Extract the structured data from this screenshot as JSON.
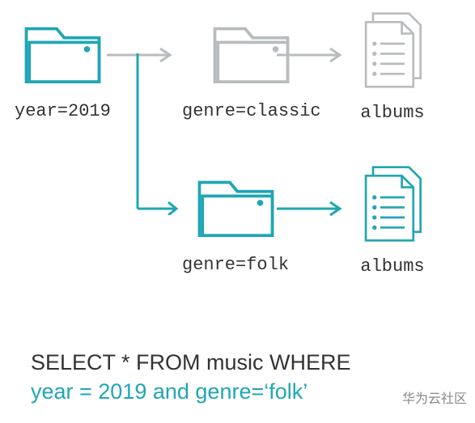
{
  "nodes": {
    "root": {
      "label": "year=2019"
    },
    "classic": {
      "label": "genre=classic"
    },
    "folk": {
      "label": "genre=folk"
    },
    "albums_classic": {
      "label": "albums"
    },
    "albums_folk": {
      "label": "albums"
    }
  },
  "query": {
    "line1": "SELECT * FROM music WHERE",
    "line2": "year = 2019 and genre=‘folk’"
  },
  "colors": {
    "teal": "#20a6b4",
    "grey": "#b9bcbe",
    "text": "#333333"
  },
  "watermark": "华为云社区"
}
